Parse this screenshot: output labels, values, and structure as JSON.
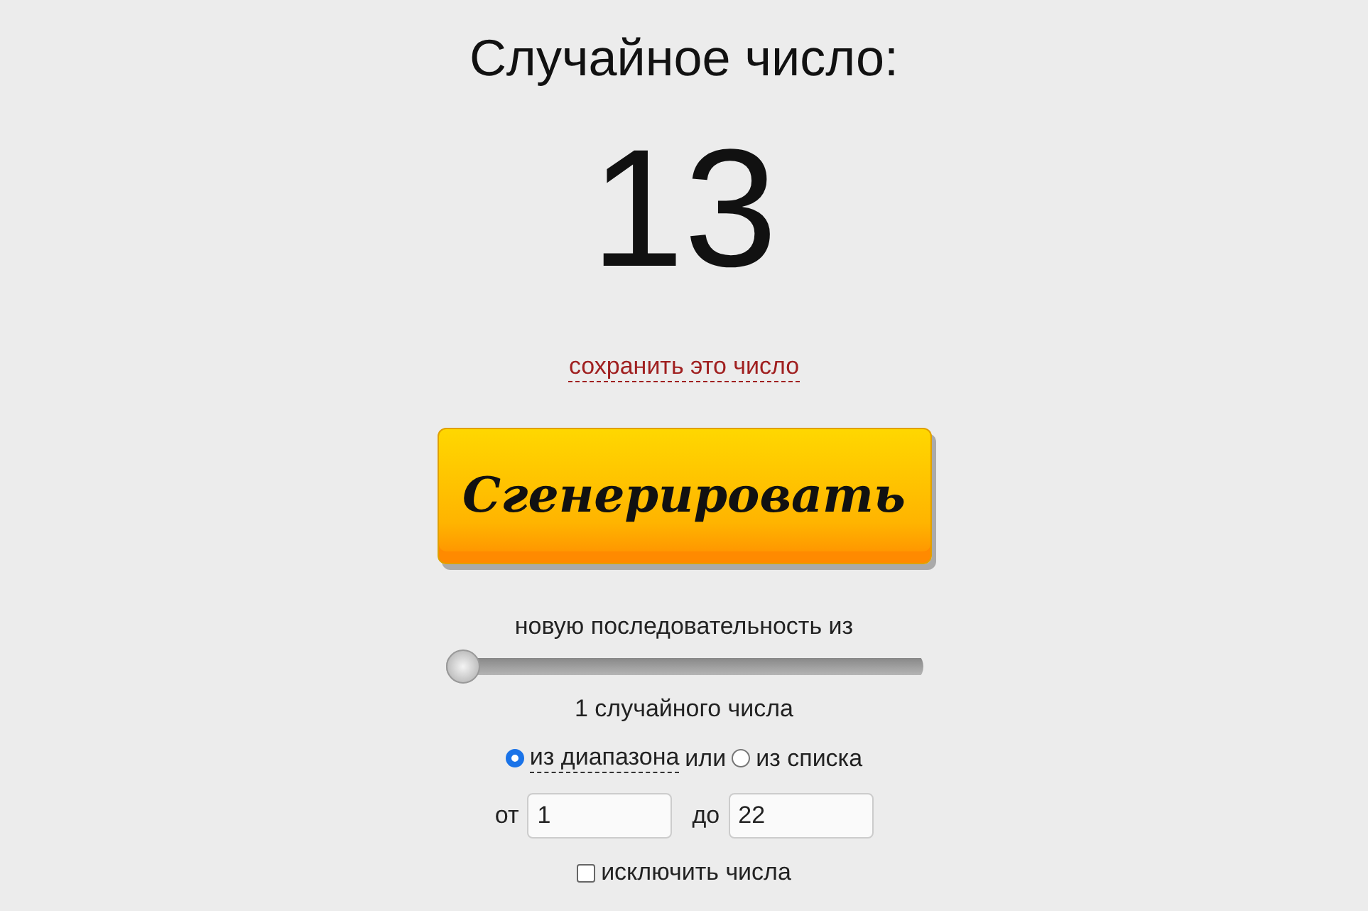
{
  "title": "Случайное число:",
  "result": "13",
  "save_link": "сохранить это число",
  "generate_button": "Сгенерировать",
  "sequence_label": "новую последовательность из",
  "count_slider": {
    "level": 0
  },
  "count_label": "1 случайного числа",
  "source_options": [
    {
      "label": "из диапазона",
      "selected": true,
      "dashed": true
    },
    {
      "label": "из списка",
      "selected": false,
      "dashed": false
    }
  ],
  "source_joiner": "или",
  "range": {
    "from_label": "от",
    "from_value": "1",
    "to_label": "до",
    "to_value": "22"
  },
  "exclude": {
    "label": "исключить числа",
    "checked": false
  }
}
